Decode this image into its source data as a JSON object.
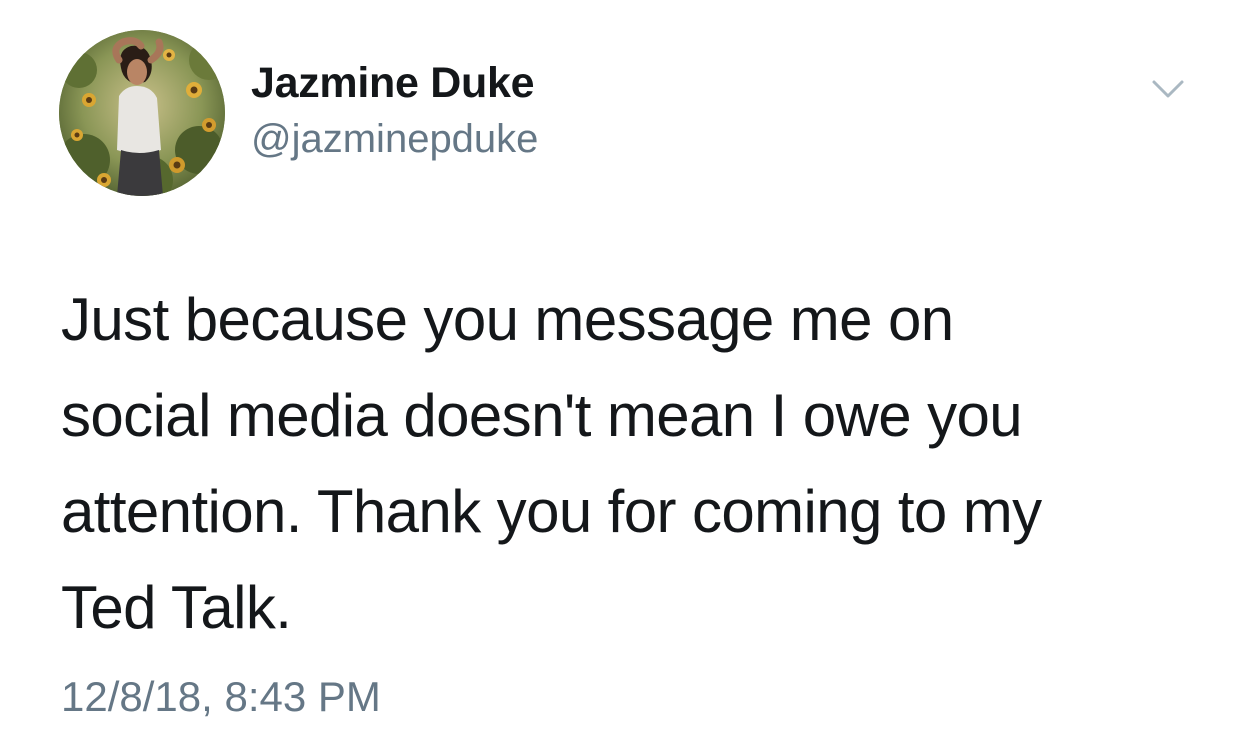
{
  "author": {
    "display_name": "Jazmine Duke",
    "handle": "@jazminepduke"
  },
  "avatar_icon": "profile-photo",
  "menu_icon": "chevron-down-icon",
  "tweet": {
    "text": "Just because you message me on\nsocial media doesn't mean I owe you\nattention. Thank you for coming to my\nTed Talk.",
    "timestamp": "12/8/18, 8:43 PM"
  },
  "colors": {
    "text_primary": "#14171a",
    "text_secondary": "#657786",
    "caret": "#aab8c2",
    "background": "#ffffff"
  }
}
